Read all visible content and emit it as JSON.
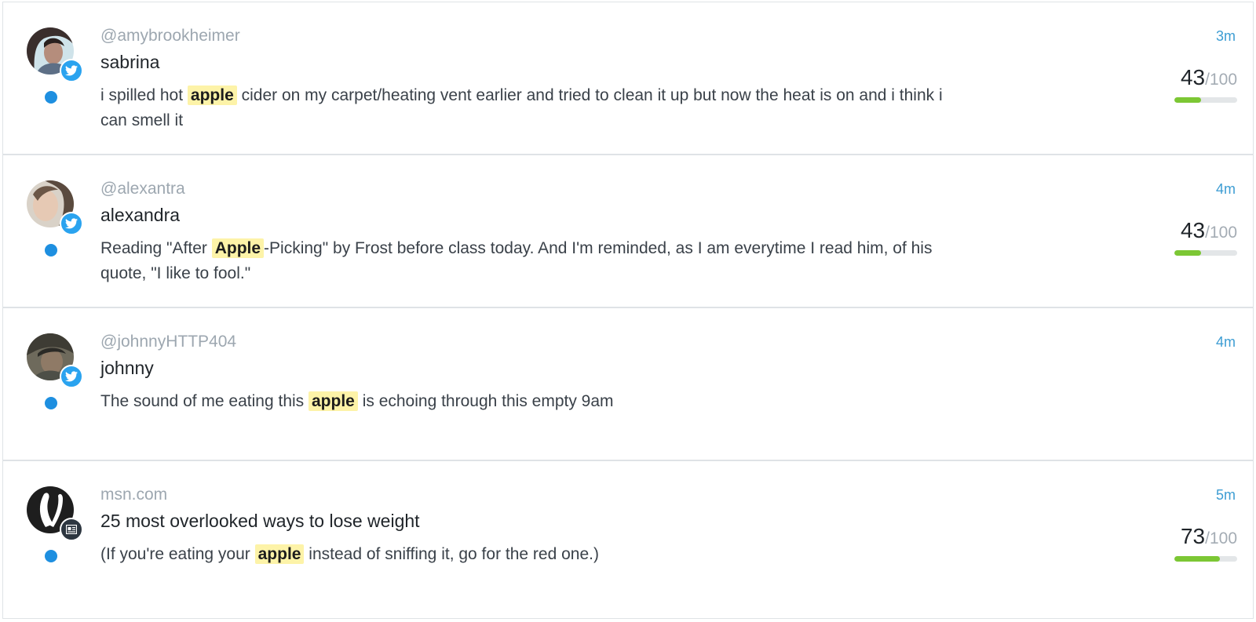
{
  "colors": {
    "twitter_badge": "#2aa3ef",
    "news_badge": "#2d3640",
    "unread_dot": "#1e8fe0",
    "highlight": "#fdf3a8",
    "timestamp": "#3d9dd3",
    "score_bar_fill": "#7cc734",
    "score_bar_track": "#e3e6e8"
  },
  "items": [
    {
      "handle": "@amybrookheimer",
      "name": "sabrina",
      "source_icon": "twitter-icon",
      "time": "3m",
      "text": {
        "before": "i spilled hot ",
        "highlight": "apple",
        "after": " cider on my carpet/heating vent earlier and tried to clean it up but now the heat is on and i think i can smell it"
      },
      "score": {
        "value": "43",
        "max": "/100",
        "fraction": 0.43
      }
    },
    {
      "handle": "@alexantra",
      "name": "alexandra",
      "source_icon": "twitter-icon",
      "time": "4m",
      "text": {
        "before": "Reading \"After ",
        "highlight": "Apple",
        "after": "-Picking\" by Frost before class today. And I'm reminded, as I am everytime I read him, of his quote, \"I like to fool.\""
      },
      "score": {
        "value": "43",
        "max": "/100",
        "fraction": 0.43
      }
    },
    {
      "handle": "@johnnyHTTP404",
      "name": "johnny",
      "source_icon": "twitter-icon",
      "time": "4m",
      "text": {
        "before": "The sound of me eating this ",
        "highlight": "apple",
        "after": " is echoing through this empty 9am"
      },
      "score": null
    },
    {
      "handle": "msn.com",
      "name": "25 most overlooked ways to lose weight",
      "source_icon": "newspaper-icon",
      "time": "5m",
      "text": {
        "before": "(If you're eating your ",
        "highlight": "apple",
        "after": " instead of sniffing it, go for the red one.)"
      },
      "score": {
        "value": "73",
        "max": "/100",
        "fraction": 0.73
      }
    }
  ]
}
